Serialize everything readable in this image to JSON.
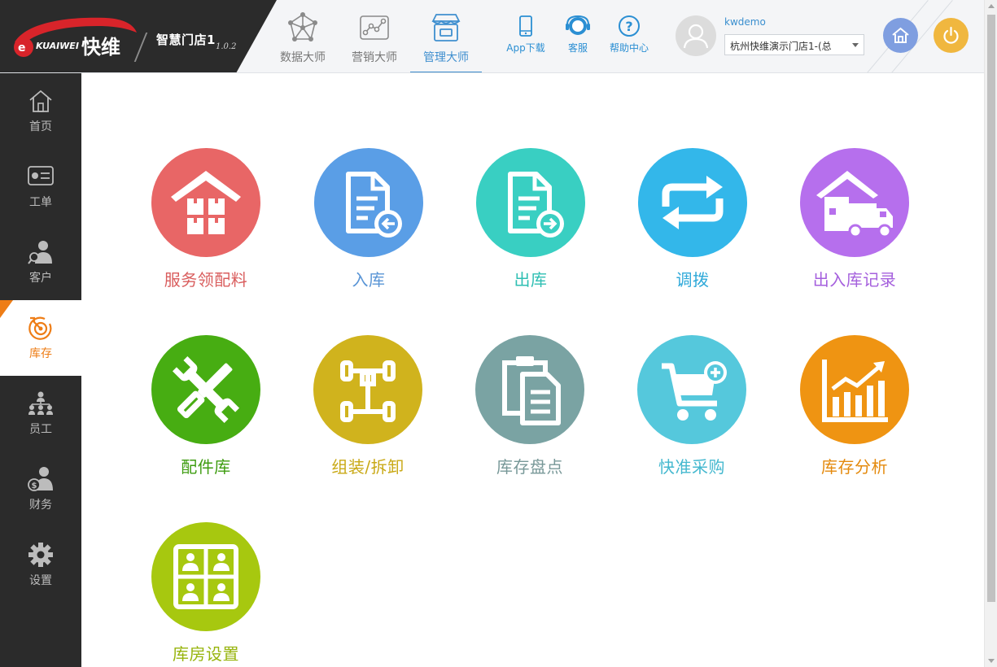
{
  "header": {
    "brand_text": "KUAIWEI",
    "brand_cn": "快维",
    "app_title": "智慧门店1",
    "version": "1.0.2",
    "tabs": [
      {
        "label": "数据大师",
        "icon": "network-icon"
      },
      {
        "label": "营销大师",
        "icon": "chart-line-icon"
      },
      {
        "label": "管理大师",
        "icon": "storefront-icon",
        "active": true
      }
    ],
    "utilities": [
      {
        "label": "App下载",
        "icon": "phone-icon"
      },
      {
        "label": "客服",
        "icon": "headset-icon"
      },
      {
        "label": "帮助中心",
        "icon": "help-icon"
      }
    ],
    "username": "kwdemo",
    "store": "杭州快维演示门店1-(总",
    "home_color": "#7f9ee0",
    "power_color": "#f0b73f"
  },
  "sidebar": {
    "items": [
      {
        "label": "首页",
        "icon": "home-icon"
      },
      {
        "label": "工单",
        "icon": "work-order-icon"
      },
      {
        "label": "客户",
        "icon": "customer-icon"
      },
      {
        "label": "库存",
        "icon": "inventory-target-icon",
        "active": true
      },
      {
        "label": "员工",
        "icon": "org-chart-icon"
      },
      {
        "label": "财务",
        "icon": "finance-icon"
      },
      {
        "label": "设置",
        "icon": "gear-icon"
      }
    ],
    "active_color": "#ee7d16"
  },
  "modules": [
    {
      "label": "服务领配料",
      "icon": "warehouse-icon",
      "color": "#e86666",
      "text_color": "#d95d5d"
    },
    {
      "label": "入库",
      "icon": "doc-in-icon",
      "color": "#5a9ee6",
      "text_color": "#5a95d6"
    },
    {
      "label": "出库",
      "icon": "doc-out-icon",
      "color": "#39cfc2",
      "text_color": "#2fbfb3"
    },
    {
      "label": "调拨",
      "icon": "transfer-icon",
      "color": "#33b7ea",
      "text_color": "#2fa9d9"
    },
    {
      "label": "出入库记录",
      "icon": "delivery-truck-icon",
      "color": "#b66fed",
      "text_color": "#a560dd"
    },
    {
      "label": "配件库",
      "icon": "tools-icon",
      "color": "#47ad12",
      "text_color": "#3e9c10"
    },
    {
      "label": "组装/拆卸",
      "icon": "chassis-icon",
      "color": "#d0b31d",
      "text_color": "#c9a916"
    },
    {
      "label": "库存盘点",
      "icon": "clipboard-icon",
      "color": "#7aa3a3",
      "text_color": "#789898"
    },
    {
      "label": "快准采购",
      "icon": "cart-add-icon",
      "color": "#55c8dc",
      "text_color": "#44b8cf"
    },
    {
      "label": "库存分析",
      "icon": "bar-chart-icon",
      "color": "#ef9412",
      "text_color": "#e48a0d"
    },
    {
      "label": "库房设置",
      "icon": "staff-grid-icon",
      "color": "#a7c80f",
      "text_color": "#97b40c"
    }
  ]
}
